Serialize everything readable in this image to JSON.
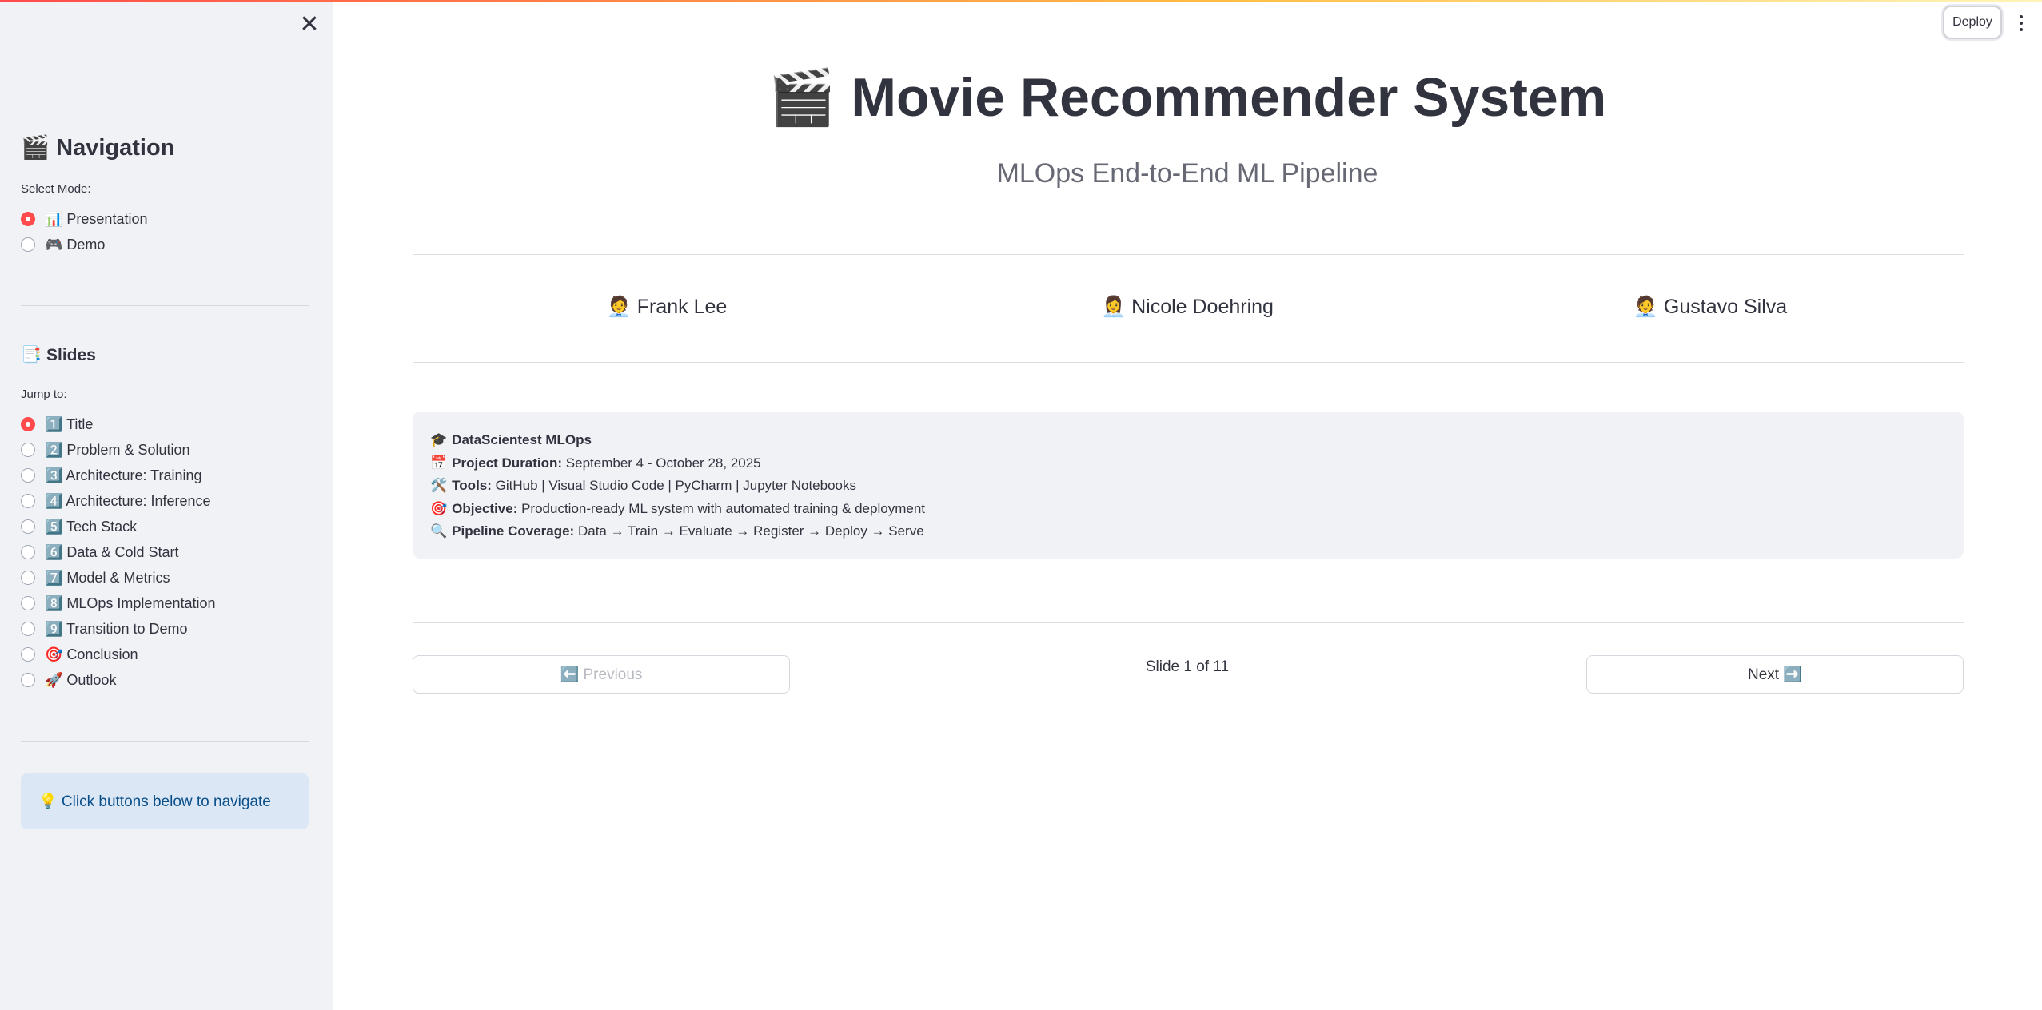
{
  "sidebar": {
    "close_icon": "✕",
    "navigation_title": "🎬 Navigation",
    "mode_label": "Select Mode:",
    "modes": [
      {
        "label": "📊 Presentation",
        "selected": true
      },
      {
        "label": "🎮 Demo",
        "selected": false
      }
    ],
    "slides_title": "📑 Slides",
    "jump_label": "Jump to:",
    "slides": [
      {
        "label": "1️⃣ Title",
        "selected": true
      },
      {
        "label": "2️⃣ Problem & Solution",
        "selected": false
      },
      {
        "label": "3️⃣ Architecture: Training",
        "selected": false
      },
      {
        "label": "4️⃣ Architecture: Inference",
        "selected": false
      },
      {
        "label": "5️⃣ Tech Stack",
        "selected": false
      },
      {
        "label": "6️⃣ Data & Cold Start",
        "selected": false
      },
      {
        "label": "7️⃣ Model & Metrics",
        "selected": false
      },
      {
        "label": "8️⃣ MLOps Implementation",
        "selected": false
      },
      {
        "label": "9️⃣ Transition to Demo",
        "selected": false
      },
      {
        "label": "🎯 Conclusion",
        "selected": false
      },
      {
        "label": "🚀 Outlook",
        "selected": false
      }
    ],
    "tip": "💡 Click buttons below to navigate"
  },
  "header": {
    "deploy_label": "Deploy",
    "menu_icon": "kebab-menu-icon"
  },
  "main": {
    "title": "🎬 Movie Recommender System",
    "subtitle": "MLOps End-to-End ML Pipeline",
    "team": [
      "🧑‍💼 Frank Lee",
      "👩‍💼 Nicole Doehring",
      "🧑‍💼 Gustavo Silva"
    ],
    "info": {
      "line1_icon": "🎓",
      "line1_bold": "DataScientest MLOps",
      "line2_icon": "📅",
      "line2_bold": "Project Duration:",
      "line2_text": " September 4 - October 28, 2025",
      "line3_icon": "🛠️",
      "line3_bold": "Tools:",
      "line3_text": " GitHub | Visual Studio Code | PyCharm | Jupyter Notebooks",
      "line4_icon": "🎯",
      "line4_bold": "Objective:",
      "line4_text": " Production-ready ML system with automated training & deployment",
      "line5_icon": "🔍",
      "line5_bold": "Pipeline Coverage:",
      "line5_text": " Data → Train → Evaluate → Register → Deploy → Serve"
    },
    "prev_label": "⬅️ Previous",
    "next_label": "Next ➡️",
    "slide_counter": "Slide 1 of 11"
  },
  "colors": {
    "accent": "#ff4b4b",
    "sidebar_bg": "#f0f2f6",
    "info_bg": "#dbe7f5",
    "info_text": "#0b4f8a"
  }
}
